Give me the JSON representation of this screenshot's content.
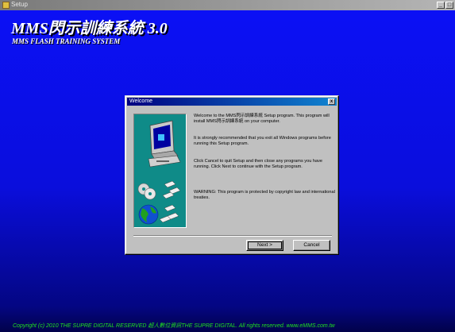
{
  "window": {
    "title": "Setup"
  },
  "app": {
    "title": "MMS閃示訓練系統 3.0",
    "subtitle": "MMS FLASH TRAINING SYSTEM",
    "copyright": "Copyright (c) 2010 THE SUPRE DIGITAL RESERVED 超人數位資訊THE SUPRE DIGITAL. All rights reserved. www.eMMS.com.tw"
  },
  "dialog": {
    "title": "Welcome",
    "paragraphs": [
      "Welcome to the MMS閃示訓練系統 Setup program. This program will install MMS閃示訓練系統 on your computer.",
      "It is strongly recommended that you exit all Windows programs before running this Setup program.",
      "Click Cancel to quit Setup and then close any programs you have running. Click Next to continue with the Setup program.",
      "WARNING: This program is protected by copyright law and international treaties."
    ],
    "next_label": "Next >",
    "cancel_label": "Cancel"
  },
  "colors": {
    "background_blue": "#0b10f5",
    "dialog_title_bar": "#000080",
    "art_panel": "#0f8b88",
    "copyright_text": "#20e020"
  },
  "icons": [
    "computer-icon",
    "discs-icon",
    "globe-icon",
    "close-icon"
  ]
}
